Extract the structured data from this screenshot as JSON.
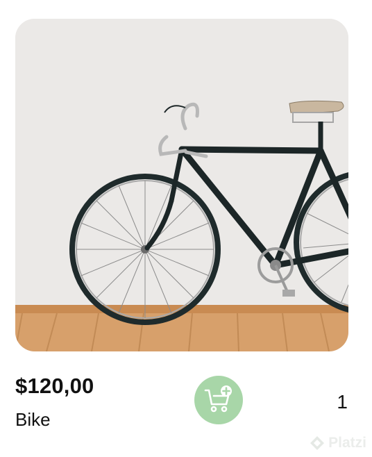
{
  "product": {
    "price": "$120,00",
    "name": "Bike",
    "image_icon": "bicycle-photo",
    "quantity": "1"
  },
  "actions": {
    "add_to_cart_icon": "cart-plus-icon",
    "accent": "#a8d6a8"
  },
  "watermark": {
    "text": "Platzi"
  }
}
